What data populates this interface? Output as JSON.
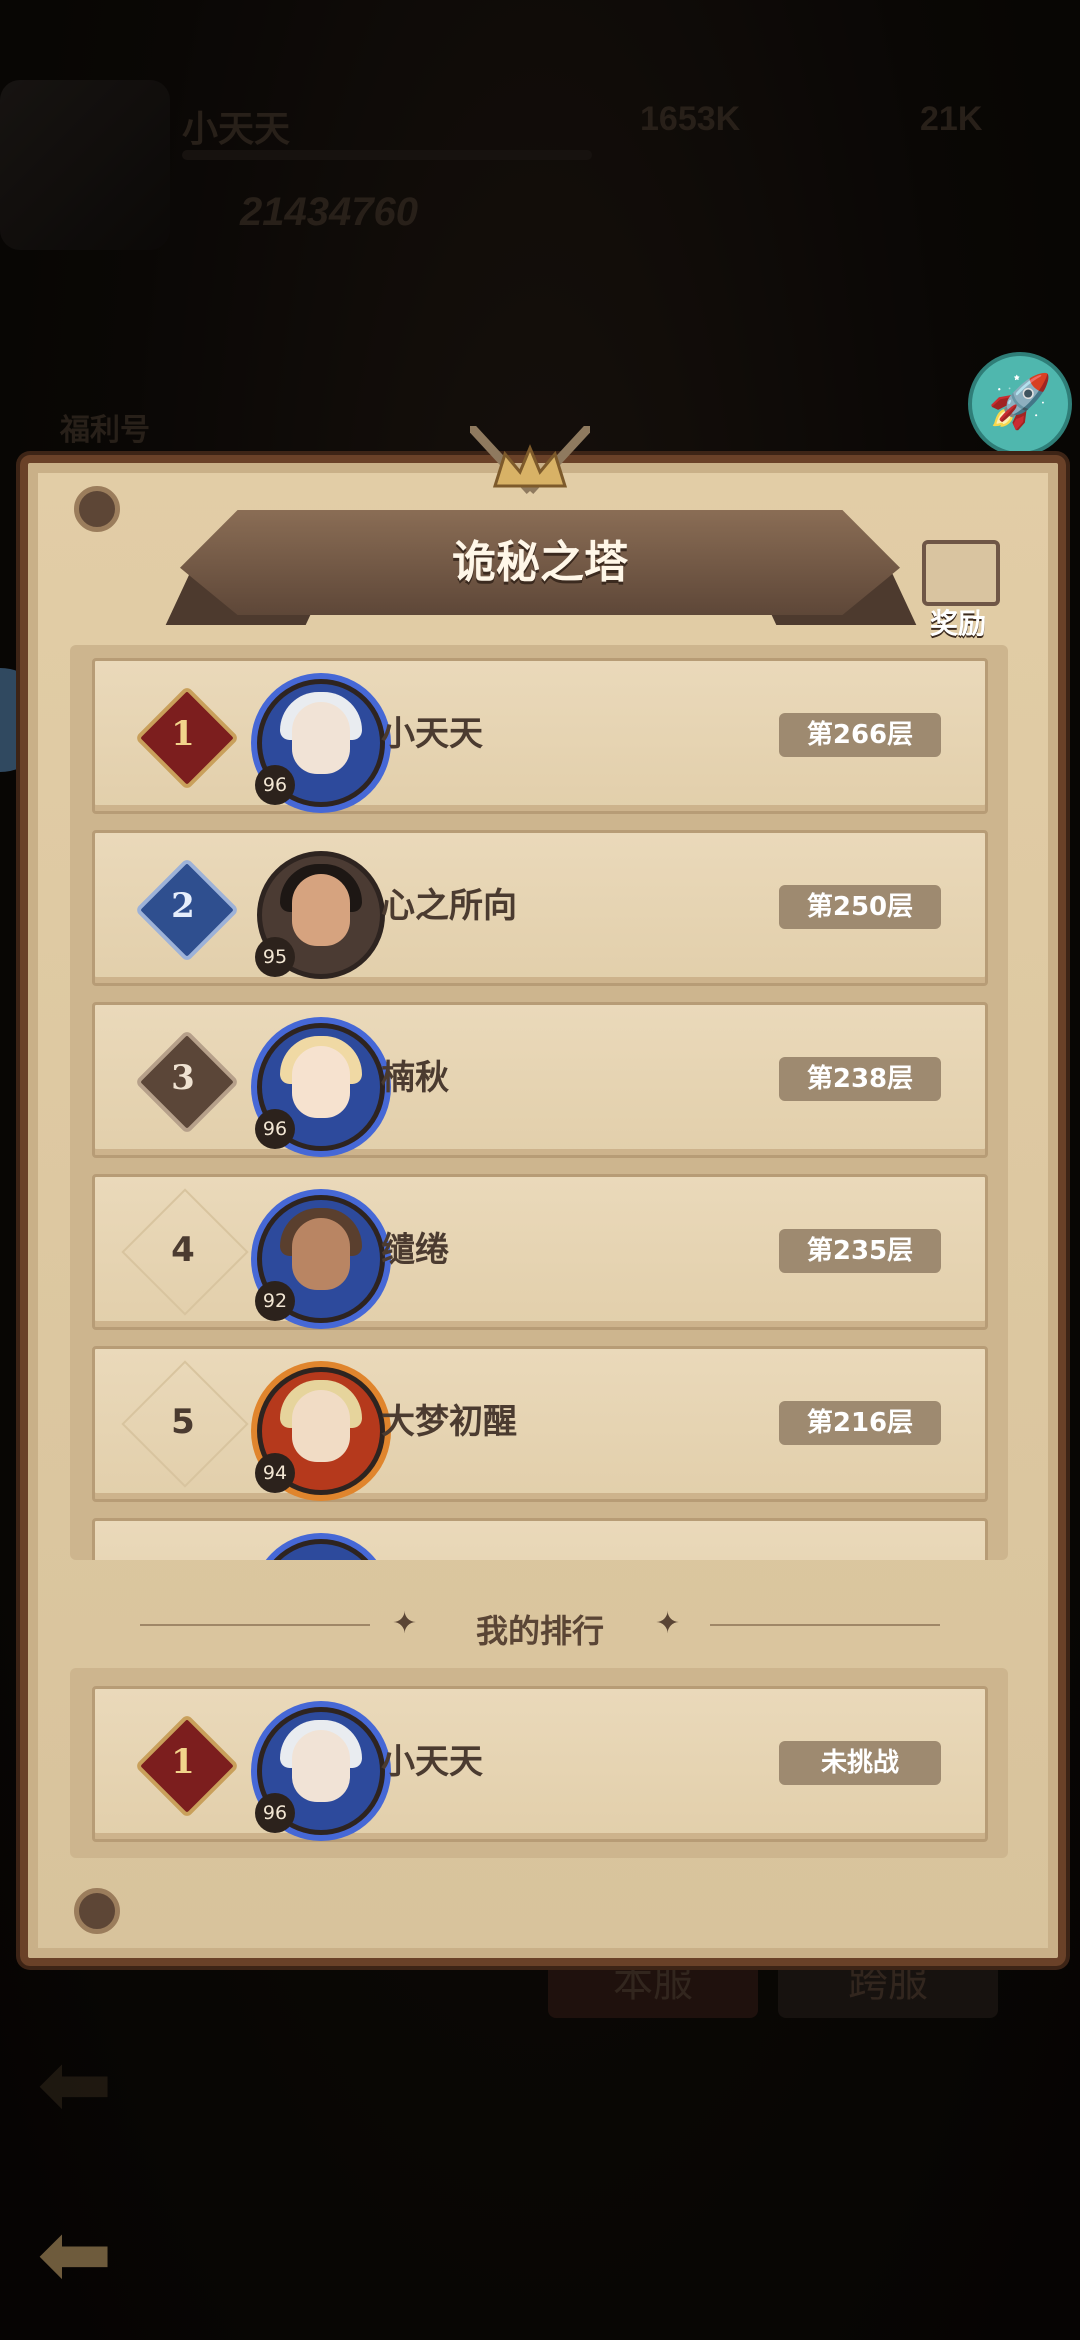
{
  "background": {
    "player_name": "小天天",
    "stat_a": "1653K",
    "stat_b": "21K",
    "power": "21434760",
    "tab_left": "本服",
    "tab_right": "跨服",
    "side_label": "福利号"
  },
  "panel": {
    "title": "诡秘之塔",
    "reward_label": "奖励",
    "my_rank_title": "我的排行"
  },
  "rankings": [
    {
      "rank": "1",
      "name": "小天天",
      "level": "96",
      "floor": "第266层",
      "style": "gold"
    },
    {
      "rank": "2",
      "name": "心之所向",
      "level": "95",
      "floor": "第250层",
      "style": "blue"
    },
    {
      "rank": "3",
      "name": "楠秋",
      "level": "96",
      "floor": "第238层",
      "style": "bronze"
    },
    {
      "rank": "4",
      "name": "缱绻",
      "level": "92",
      "floor": "第235层",
      "style": "plain"
    },
    {
      "rank": "5",
      "name": "大梦初醒",
      "level": "94",
      "floor": "第216层",
      "style": "plain"
    }
  ],
  "my_rank": {
    "rank": "1",
    "name": "小天天",
    "level": "96",
    "status": "未挑战"
  },
  "colors": {
    "panel_bg": "#e2cda6",
    "panel_border": "#6a4128",
    "rank_gold": "#7c1e1e",
    "rank_blue": "#2f4f8f",
    "rank_bronze": "#5b4638",
    "floor_badge": "#9e8a70",
    "rocket": "#4fb7ae"
  },
  "icons": [
    "rocket-icon",
    "treasure-chest-icon",
    "crossed-swords-crown-icon",
    "back-arrow-icon"
  ]
}
